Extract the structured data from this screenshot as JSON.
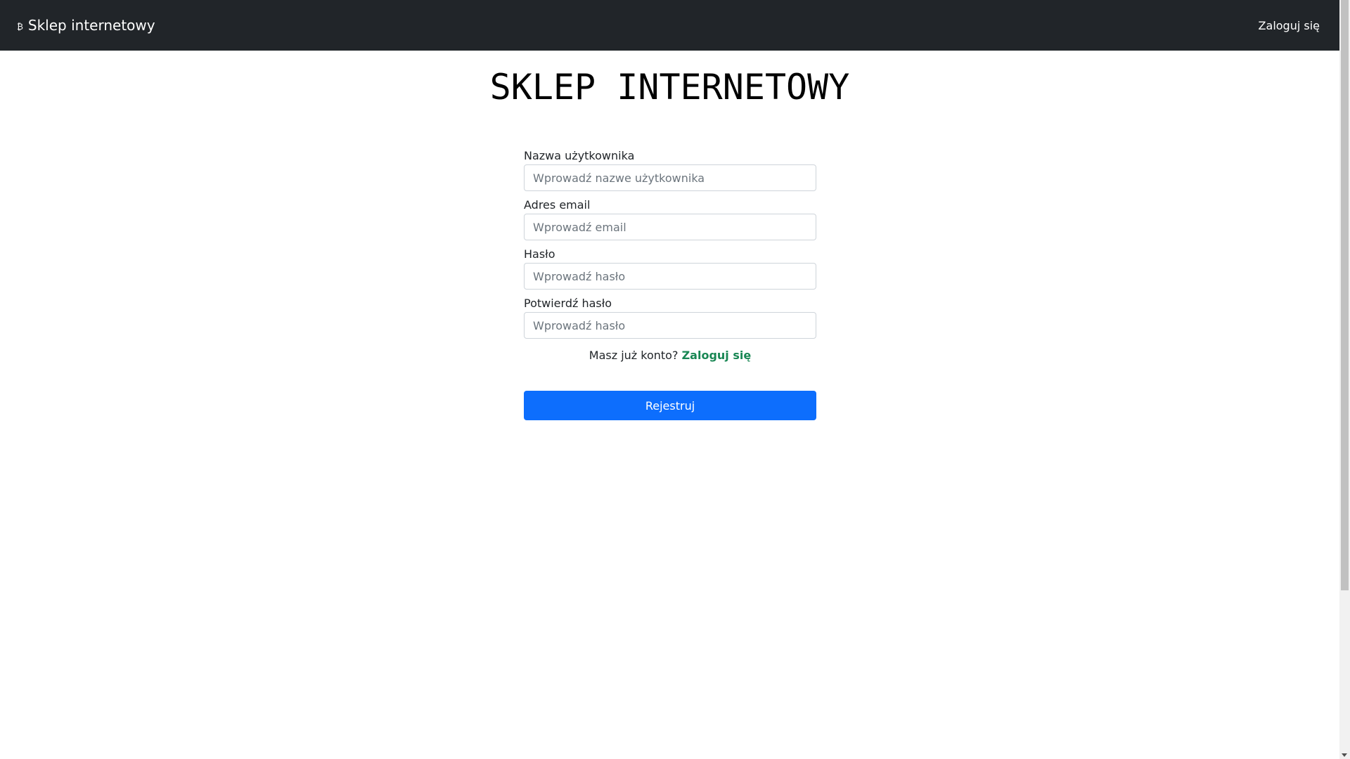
{
  "navbar": {
    "brand_icon": "bitcoin-icon",
    "brand_icon_glyph": "₿",
    "brand_title": "Sklep internetowy",
    "login_link": "Zaloguj się"
  },
  "heading": "SKLEP INTERNETOWY",
  "form": {
    "username": {
      "label": "Nazwa użytkownika",
      "placeholder": "Wprowadź nazwe użytkownika",
      "value": ""
    },
    "email": {
      "label": "Adres email",
      "placeholder": "Wprowadź email",
      "value": ""
    },
    "password": {
      "label": "Hasło",
      "placeholder": "Wprowadź hasło",
      "value": ""
    },
    "confirm_password": {
      "label": "Potwierdź hasło",
      "placeholder": "Wprowadź hasło",
      "value": ""
    },
    "already_text": "Masz już konto?",
    "already_link": "Zaloguj się",
    "submit_label": "Rejestruj"
  },
  "colors": {
    "navbar_bg": "#212529",
    "primary": "#0d6efd",
    "success_link": "#198754"
  }
}
